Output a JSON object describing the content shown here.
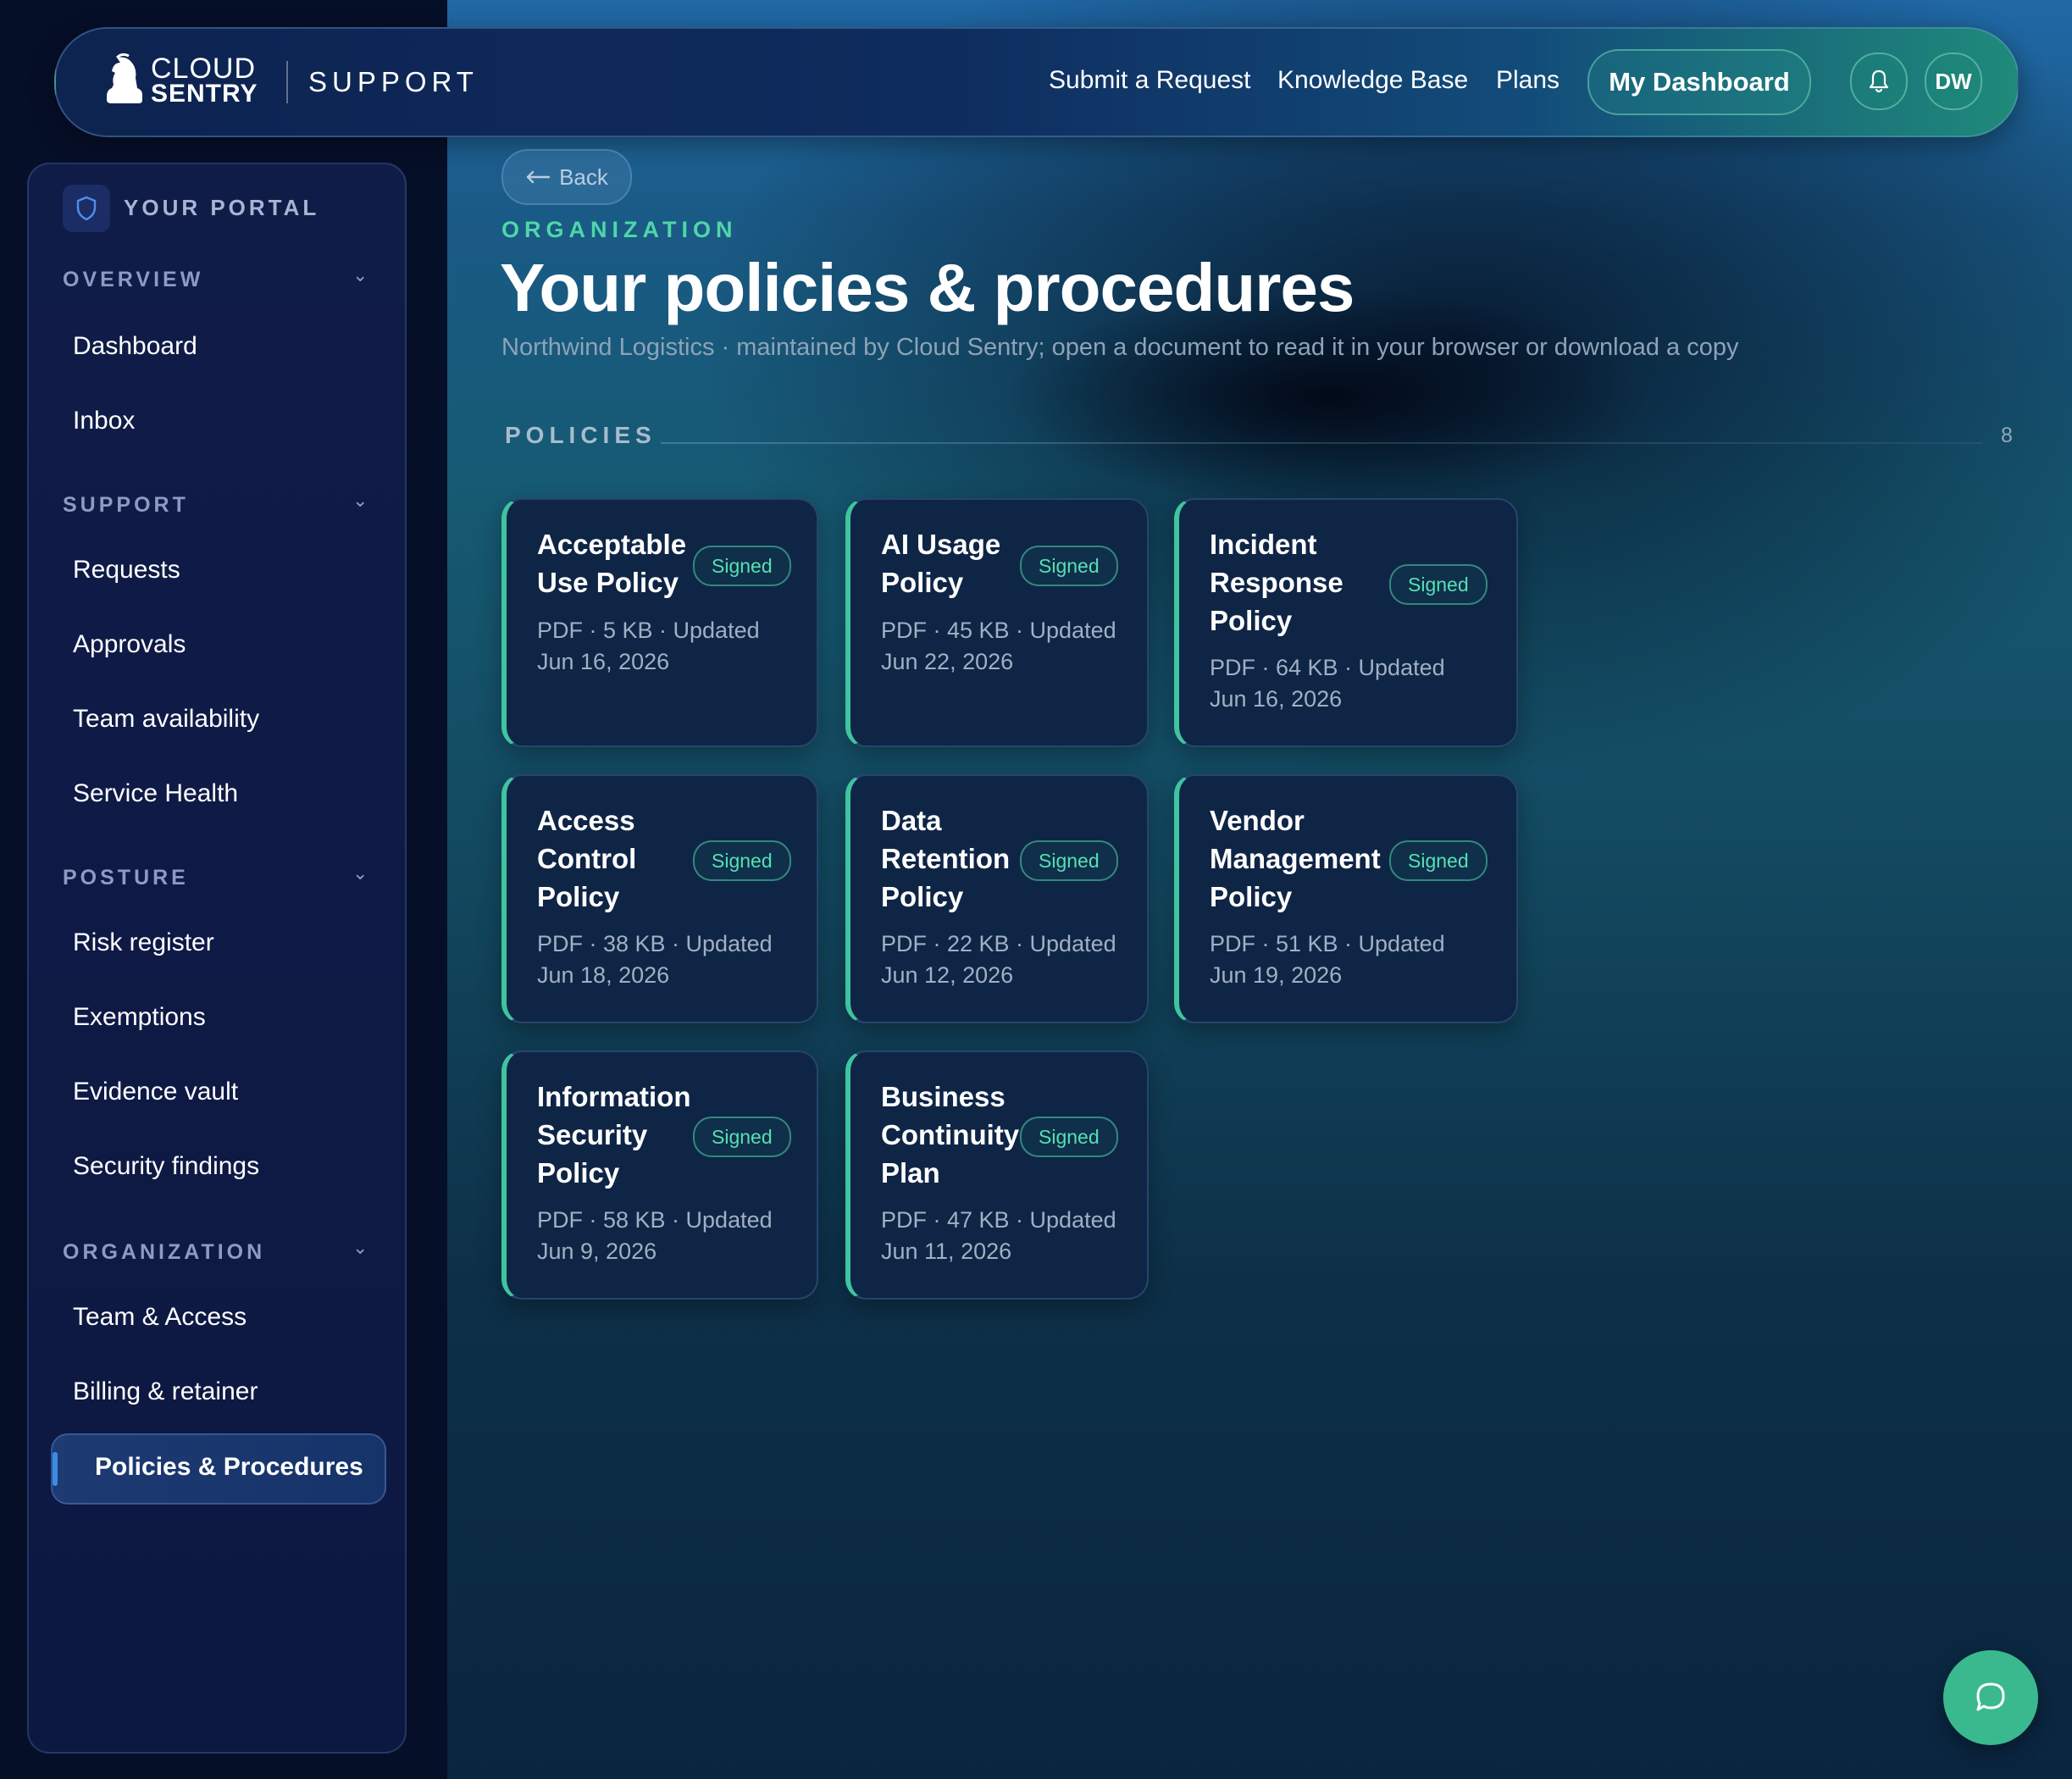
{
  "header": {
    "logo_line1": "CLOUD",
    "logo_line2": "SENTRY",
    "support_word": "SUPPORT",
    "nav": [
      "Submit a Request",
      "Knowledge Base",
      "Plans"
    ],
    "dashboard_label": "My Dashboard",
    "avatar_initials": "DW",
    "accent": "#3bb98e"
  },
  "sidebar": {
    "portal_label": "YOUR PORTAL",
    "sections": [
      {
        "title": "OVERVIEW",
        "items": [
          "Dashboard",
          "Inbox"
        ]
      },
      {
        "title": "SUPPORT",
        "items": [
          "Requests",
          "Approvals",
          "Team availability",
          "Service Health"
        ]
      },
      {
        "title": "POSTURE",
        "items": [
          "Risk register",
          "Exemptions",
          "Evidence vault",
          "Security findings"
        ]
      },
      {
        "title": "ORGANIZATION",
        "items": [
          "Team & Access",
          "Billing & retainer",
          "Policies & Procedures"
        ]
      }
    ],
    "active_item": "Policies & Procedures"
  },
  "main": {
    "back_label": "Back",
    "eyebrow": "ORGANIZATION",
    "title": "Your policies & procedures",
    "subtitle": "Northwind Logistics · maintained by Cloud Sentry; open a document to read it in your browser or download a copy",
    "section_title": "POLICIES",
    "section_count": "8",
    "policies": [
      {
        "title_lines": [
          "Acceptable",
          "Use Policy"
        ],
        "status": "Signed",
        "meta_lines": [
          "PDF · 5 KB · Updated",
          "Jun 16, 2026"
        ]
      },
      {
        "title_lines": [
          "AI Usage",
          "Policy"
        ],
        "status": "Signed",
        "meta_lines": [
          "PDF · 45 KB · Updated",
          "Jun 22, 2026"
        ]
      },
      {
        "title_lines": [
          "Incident",
          "Response",
          "Policy"
        ],
        "status": "Signed",
        "meta_lines": [
          "PDF · 64 KB · Updated",
          "Jun 16, 2026"
        ]
      },
      {
        "title_lines": [
          "Access",
          "Control",
          "Policy"
        ],
        "status": "Signed",
        "meta_lines": [
          "PDF · 38 KB · Updated",
          "Jun 18, 2026"
        ]
      },
      {
        "title_lines": [
          "Data",
          "Retention",
          "Policy"
        ],
        "status": "Signed",
        "meta_lines": [
          "PDF · 22 KB · Updated",
          "Jun 12, 2026"
        ]
      },
      {
        "title_lines": [
          "Vendor",
          "Management",
          "Policy"
        ],
        "status": "Signed",
        "meta_lines": [
          "PDF · 51 KB · Updated",
          "Jun 19, 2026"
        ]
      },
      {
        "title_lines": [
          "Information",
          "Security",
          "Policy"
        ],
        "status": "Signed",
        "meta_lines": [
          "PDF · 58 KB · Updated",
          "Jun 9, 2026"
        ]
      },
      {
        "title_lines": [
          "Business",
          "Continuity",
          "Plan"
        ],
        "status": "Signed",
        "meta_lines": [
          "PDF · 47 KB · Updated",
          "Jun 11, 2026"
        ]
      }
    ]
  },
  "icons": {
    "logo": "knight-helmet-icon",
    "bell": "bell-icon",
    "portal": "shield-icon",
    "chevron": "chevron-down-icon",
    "back": "arrow-left-icon",
    "chat": "chat-bubble-icon"
  }
}
